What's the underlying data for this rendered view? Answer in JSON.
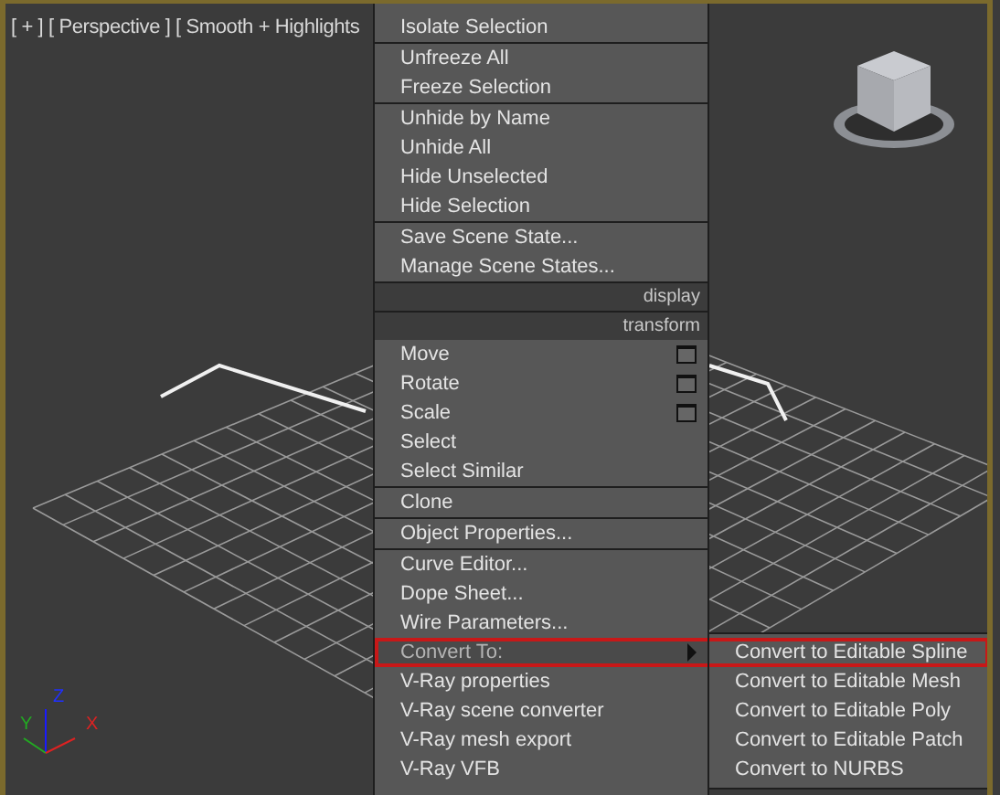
{
  "viewport": {
    "label": "[ + ] [ Perspective ] [ Smooth + Highlights"
  },
  "menu": {
    "items": [
      {
        "kind": "item",
        "label": "Isolate Selection",
        "settings": false,
        "submenu": false,
        "selected": false
      },
      {
        "kind": "separator"
      },
      {
        "kind": "item",
        "label": "Unfreeze All",
        "settings": false,
        "submenu": false,
        "selected": false
      },
      {
        "kind": "item",
        "label": "Freeze Selection",
        "settings": false,
        "submenu": false,
        "selected": false
      },
      {
        "kind": "separator"
      },
      {
        "kind": "item",
        "label": "Unhide by Name",
        "settings": false,
        "submenu": false,
        "selected": false
      },
      {
        "kind": "item",
        "label": "Unhide All",
        "settings": false,
        "submenu": false,
        "selected": false
      },
      {
        "kind": "item",
        "label": "Hide Unselected",
        "settings": false,
        "submenu": false,
        "selected": false
      },
      {
        "kind": "item",
        "label": "Hide Selection",
        "settings": false,
        "submenu": false,
        "selected": false
      },
      {
        "kind": "separator"
      },
      {
        "kind": "item",
        "label": "Save Scene State...",
        "settings": false,
        "submenu": false,
        "selected": false
      },
      {
        "kind": "item",
        "label": "Manage Scene States...",
        "settings": false,
        "submenu": false,
        "selected": false
      },
      {
        "kind": "header",
        "label": "display"
      },
      {
        "kind": "header",
        "label": "transform"
      },
      {
        "kind": "item",
        "label": "Move",
        "settings": true,
        "submenu": false,
        "selected": false
      },
      {
        "kind": "item",
        "label": "Rotate",
        "settings": true,
        "submenu": false,
        "selected": false
      },
      {
        "kind": "item",
        "label": "Scale",
        "settings": true,
        "submenu": false,
        "selected": false
      },
      {
        "kind": "item",
        "label": "Select",
        "settings": false,
        "submenu": false,
        "selected": false
      },
      {
        "kind": "item",
        "label": "Select Similar",
        "settings": false,
        "submenu": false,
        "selected": false
      },
      {
        "kind": "separator"
      },
      {
        "kind": "item",
        "label": "Clone",
        "settings": false,
        "submenu": false,
        "selected": false
      },
      {
        "kind": "separator"
      },
      {
        "kind": "item",
        "label": "Object Properties...",
        "settings": false,
        "submenu": false,
        "selected": false
      },
      {
        "kind": "separator"
      },
      {
        "kind": "item",
        "label": "Curve Editor...",
        "settings": false,
        "submenu": false,
        "selected": false
      },
      {
        "kind": "item",
        "label": "Dope Sheet...",
        "settings": false,
        "submenu": false,
        "selected": false
      },
      {
        "kind": "item",
        "label": "Wire Parameters...",
        "settings": false,
        "submenu": false,
        "selected": false
      },
      {
        "kind": "item",
        "label": "Convert To:",
        "settings": false,
        "submenu": true,
        "selected": true
      },
      {
        "kind": "item",
        "label": "V-Ray properties",
        "settings": false,
        "submenu": false,
        "selected": false
      },
      {
        "kind": "item",
        "label": "V-Ray scene converter",
        "settings": false,
        "submenu": false,
        "selected": false
      },
      {
        "kind": "item",
        "label": "V-Ray mesh export",
        "settings": false,
        "submenu": false,
        "selected": false
      },
      {
        "kind": "item",
        "label": "V-Ray VFB",
        "settings": false,
        "submenu": false,
        "selected": false
      }
    ]
  },
  "submenu": {
    "items": [
      {
        "label": "Convert to Editable Spline",
        "selected": true
      },
      {
        "label": "Convert to Editable Mesh",
        "selected": false
      },
      {
        "label": "Convert to Editable Poly",
        "selected": false
      },
      {
        "label": "Convert to Editable Patch",
        "selected": false
      },
      {
        "label": "Convert to NURBS",
        "selected": false
      }
    ]
  },
  "axis_labels": [
    "Z",
    "Y",
    "X"
  ]
}
